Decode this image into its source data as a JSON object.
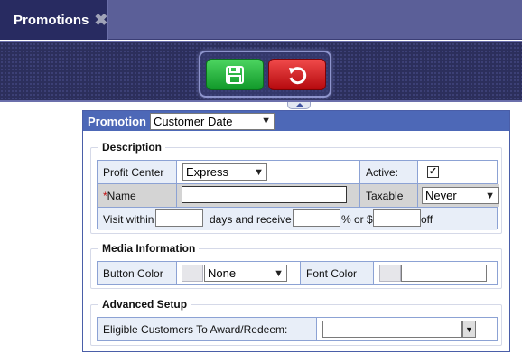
{
  "tab": {
    "title": "Promotions",
    "close_glyph": "✖"
  },
  "toolbar": {
    "save_icon": "floppy-disk-icon",
    "undo_icon": "undo-icon",
    "save_color": "#1fb335",
    "undo_color": "#dc1e22"
  },
  "promotion": {
    "label": "Promotion",
    "type_value": "Customer Date"
  },
  "description": {
    "legend": "Description",
    "profit_center_label": "Profit Center",
    "profit_center_value": "Express",
    "active_label": "Active:",
    "active_checked": "✓",
    "name_required_mark": "*",
    "name_label": "Name",
    "name_value": "",
    "taxable_label": "Taxable",
    "taxable_value": "Never",
    "visit_within_label": "Visit within",
    "visit_within_value": "",
    "days_receive_label": "days and receive",
    "percent_value": "",
    "percent_or_label": "% or $",
    "dollar_value": "",
    "off_label": "off"
  },
  "media": {
    "legend": "Media Information",
    "button_color_label": "Button Color",
    "button_color_value": "None",
    "font_color_label": "Font Color",
    "font_color_value": ""
  },
  "advanced": {
    "legend": "Advanced Setup",
    "eligible_label": "Eligible Customers To Award/Redeem:",
    "eligible_value": ""
  }
}
